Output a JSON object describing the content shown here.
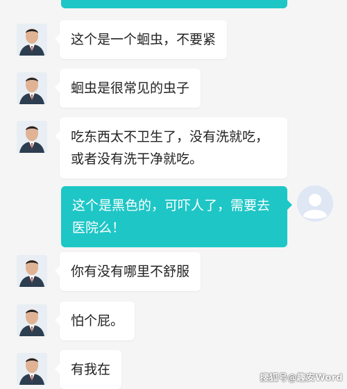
{
  "messages": [
    {
      "sender": "other",
      "text": "这个是一个蛔虫，不要紧"
    },
    {
      "sender": "other",
      "text": "蛔虫是很常见的虫子"
    },
    {
      "sender": "other",
      "text": "吃东西太不卫生了，没有洗就吃，或者没有洗干净就吃。"
    },
    {
      "sender": "me",
      "text": "这个是黑色的，可吓人了，需要去医院么！"
    },
    {
      "sender": "other",
      "text": "你有没有哪里不舒服"
    },
    {
      "sender": "other",
      "text": "怕个屁。"
    },
    {
      "sender": "other",
      "text": "有我在"
    }
  ],
  "watermark": "搜狐号@趣安Word",
  "colors": {
    "background": "#f5f5f5",
    "received_bubble": "#ffffff",
    "sent_bubble": "#1fc6c6",
    "sent_text": "#ffffff"
  },
  "icons": {
    "other_avatar": "doctor-photo-avatar",
    "user_avatar": "default-user-avatar"
  }
}
